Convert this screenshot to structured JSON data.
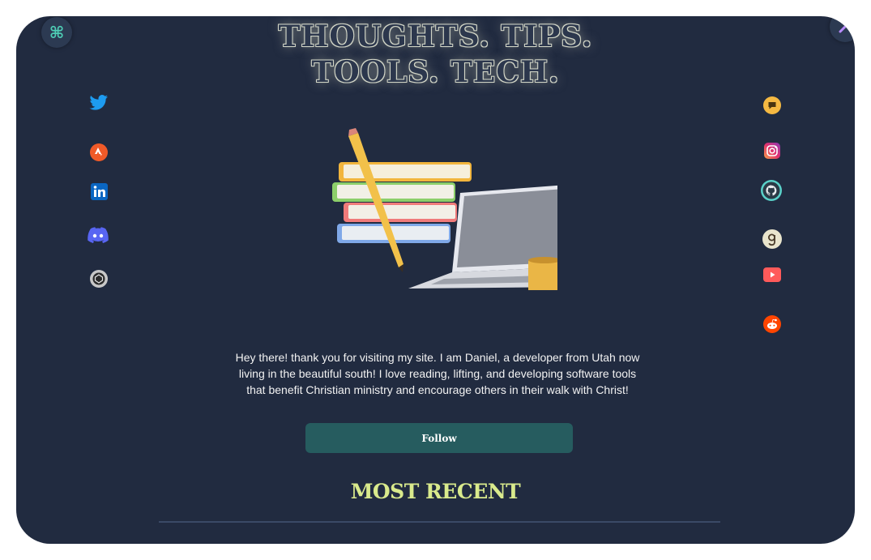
{
  "header": {
    "line1": "THOUGHTS. TIPS.",
    "line2": "TOOLS. TECH."
  },
  "corner": {
    "left_icon": "command-icon",
    "right_icon": "magic-wand-icon"
  },
  "social_left": [
    {
      "name": "twitter-icon",
      "color": "#1d9bf0"
    },
    {
      "name": "strava-icon",
      "color": "#f05a28"
    },
    {
      "name": "linkedin-icon",
      "color": "#0a66c2"
    },
    {
      "name": "discord-icon",
      "color": "#5865f2"
    },
    {
      "name": "codepen-icon",
      "color": "#c8c8c8"
    }
  ],
  "social_right": [
    {
      "name": "chat-icon",
      "color": "#f5b942"
    },
    {
      "name": "instagram-icon",
      "color": "#e1306c"
    },
    {
      "name": "github-icon",
      "color": "#5ad1c9"
    },
    {
      "name": "goodreads-icon",
      "color": "#e9e5cd"
    },
    {
      "name": "youtube-icon",
      "color": "#ff5a5a"
    },
    {
      "name": "reddit-icon",
      "color": "#ff4500"
    }
  ],
  "bio": {
    "line1": "Hey there! thank you for visiting my site. I am Daniel, a developer from Utah now",
    "line2": "living in the beautiful south! I love reading, lifting, and developing software tools",
    "line3": "that benefit Christian ministry and encourage others in their walk with Christ!"
  },
  "follow_label": "Follow",
  "section_title": "MOST RECENT"
}
